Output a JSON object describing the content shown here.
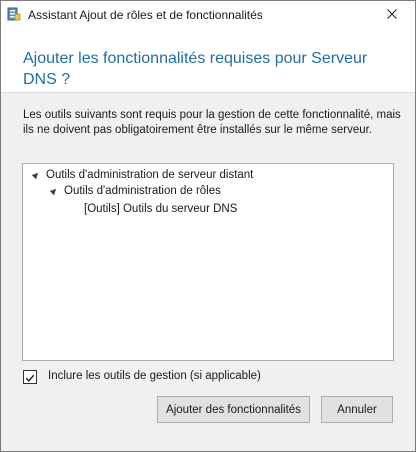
{
  "window": {
    "title": "Assistant Ajout de rôles et de fonctionnalités",
    "icons": {
      "app": "server-manager-icon",
      "close": "close-icon"
    }
  },
  "header": {
    "heading": "Ajouter les fonctionnalités requises pour Serveur DNS ?"
  },
  "description": "Les outils suivants sont requis pour la gestion de cette fonctionnalité, mais ils ne doivent pas obligatoirement être installés sur le même serveur.",
  "tree": {
    "nodes": [
      {
        "label": "Outils d'administration de serveur distant",
        "expanded": true
      },
      {
        "label": "Outils d'administration de rôles",
        "expanded": true
      },
      {
        "label": "[Outils] Outils du serveur DNS"
      }
    ]
  },
  "options": {
    "include_tools_label": "Inclure les outils de gestion (si applicable)",
    "include_tools_checked": true
  },
  "buttons": {
    "add_label": "Ajouter des fonctionnalités",
    "cancel_label": "Annuler"
  },
  "colors": {
    "heading": "#1e6ea7",
    "dialog_bg": "#f0f0f0",
    "button_bg": "#e1e1e1"
  }
}
